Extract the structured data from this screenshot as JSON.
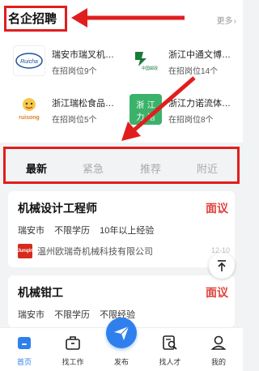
{
  "featured": {
    "title": "名企招聘",
    "more_label": "更多"
  },
  "companies": [
    {
      "name": "瑞安市瑞叉机械有限公司",
      "jobs": "在招岗位9个",
      "logo_text": "Ruicha"
    },
    {
      "name": "浙江中通文博服务有限公司",
      "jobs": "在招岗位14个",
      "logo_text": "中国邮政"
    },
    {
      "name": "浙江瑞松食品有限公司",
      "jobs": "在招岗位5个",
      "logo_text": "ruisong"
    },
    {
      "name": "浙江力诺流体控制科技",
      "jobs": "在招岗位8个",
      "logo_text": "浙江力诺"
    }
  ],
  "tabs": [
    "最新",
    "紧急",
    "推荐",
    "附近"
  ],
  "active_tab": "最新",
  "jobs": [
    {
      "title": "机械设计工程师",
      "salary": "面议",
      "tags": [
        "瑞安市",
        "不限学历",
        "10年以上经验"
      ],
      "company": "温州欧瑞奇机械科技有限公司",
      "company_logo": "Junqin",
      "time": "12-10"
    },
    {
      "title": "机械钳工",
      "salary": "面议",
      "tags": [
        "瑞安市",
        "不限学历",
        "不限经验"
      ]
    }
  ],
  "nav": [
    {
      "label": "首页",
      "icon": "home-icon",
      "active": true
    },
    {
      "label": "找工作",
      "icon": "briefcase-icon",
      "active": false
    },
    {
      "label": "发布",
      "icon": "send-icon",
      "active": false
    },
    {
      "label": "找人才",
      "icon": "search-talent-icon",
      "active": false
    },
    {
      "label": "我的",
      "icon": "user-icon",
      "active": false
    }
  ],
  "colors": {
    "accent": "#2f80ed",
    "salary": "#e0413a",
    "annotation": "#e01e1e"
  }
}
